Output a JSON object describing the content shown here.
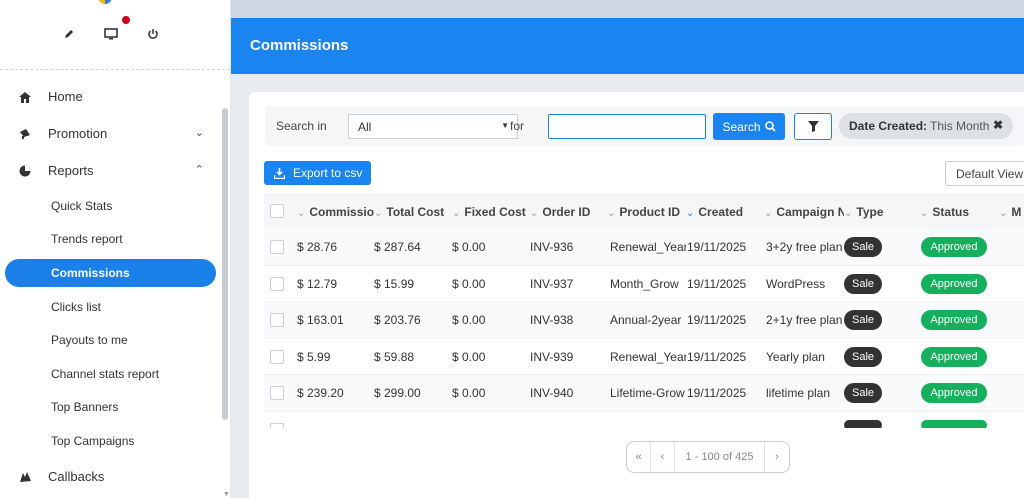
{
  "sidebar": {
    "top_icons": [
      "edit-icon",
      "monitor-icon",
      "power-icon"
    ],
    "items": [
      {
        "label": "Home",
        "icon": "home-icon"
      },
      {
        "label": "Promotion",
        "icon": "megaphone-icon"
      },
      {
        "label": "Reports",
        "icon": "pie-chart-icon"
      }
    ],
    "reports_sub": [
      "Quick Stats",
      "Trends report",
      "Commissions",
      "Clicks list",
      "Payouts to me",
      "Channel stats report",
      "Top Banners",
      "Top Campaigns"
    ],
    "callbacks": "Callbacks"
  },
  "page_title": "Commissions",
  "filter": {
    "search_in_label": "Search in",
    "search_in_value": "All",
    "for_label": "for",
    "search_value": "",
    "search_button": "Search",
    "chip_key": "Date Created:",
    "chip_value": "This Month"
  },
  "toolbar": {
    "export_label": "Export to csv",
    "view_label": "Default View"
  },
  "table": {
    "headers": [
      "Commissio",
      "Total Cost",
      "Fixed Cost",
      "Order ID",
      "Product ID",
      "Created",
      "Campaign N",
      "Type",
      "Status",
      "M"
    ],
    "rows": [
      {
        "commission": "$ 28.76",
        "total": "$ 287.64",
        "fixed": "$ 0.00",
        "order": "INV-936",
        "product": "Renewal_Yearl",
        "created": "19/11/2025",
        "campaign": "3+2y free plan",
        "type": "Sale",
        "status": "Approved"
      },
      {
        "commission": "$ 12.79",
        "total": "$ 15.99",
        "fixed": "$ 0.00",
        "order": "INV-937",
        "product": "Month_Grow",
        "created": "19/11/2025",
        "campaign": "WordPress",
        "type": "Sale",
        "status": "Approved"
      },
      {
        "commission": "$ 163.01",
        "total": "$ 203.76",
        "fixed": "$ 0.00",
        "order": "INV-938",
        "product": "Annual-2year",
        "created": "19/11/2025",
        "campaign": "2+1y free plan",
        "type": "Sale",
        "status": "Approved"
      },
      {
        "commission": "$ 5.99",
        "total": "$ 59.88",
        "fixed": "$ 0.00",
        "order": "INV-939",
        "product": "Renewal_Yearl",
        "created": "19/11/2025",
        "campaign": "Yearly plan",
        "type": "Sale",
        "status": "Approved"
      },
      {
        "commission": "$ 239.20",
        "total": "$ 299.00",
        "fixed": "$ 0.00",
        "order": "INV-940",
        "product": "Lifetime-Grow",
        "created": "19/11/2025",
        "campaign": "lifetime plan",
        "type": "Sale",
        "status": "Approved"
      }
    ]
  },
  "pager": {
    "first": "«",
    "prev": "‹",
    "range": "1 - 100 of 425",
    "next": "›"
  },
  "colors": {
    "primary": "#1a85f0",
    "approved": "#14b05d",
    "sale": "#333333"
  }
}
